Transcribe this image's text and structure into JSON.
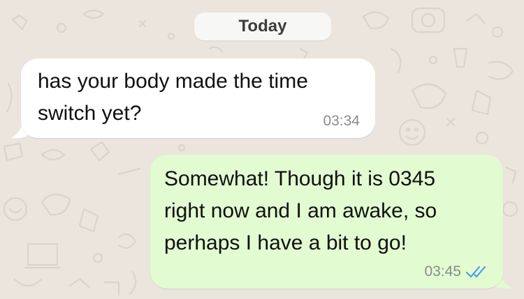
{
  "chat": {
    "day_label": "Today",
    "messages": [
      {
        "direction": "incoming",
        "text": "has your body made the time\nswitch yet?",
        "time": "03:34"
      },
      {
        "direction": "outgoing",
        "text": "Somewhat! Though it is 0345\nright now and I am awake, so\nperhaps I have a bit to go!",
        "time": "03:45",
        "status_icon": "double-check-read-icon"
      }
    ]
  },
  "colors": {
    "wallpaper": "#ece5dd",
    "incoming_bubble": "#ffffff",
    "outgoing_bubble": "#e2fbd1",
    "read_ticks": "#4fa3e6",
    "timestamp": "#8a8a8a"
  }
}
